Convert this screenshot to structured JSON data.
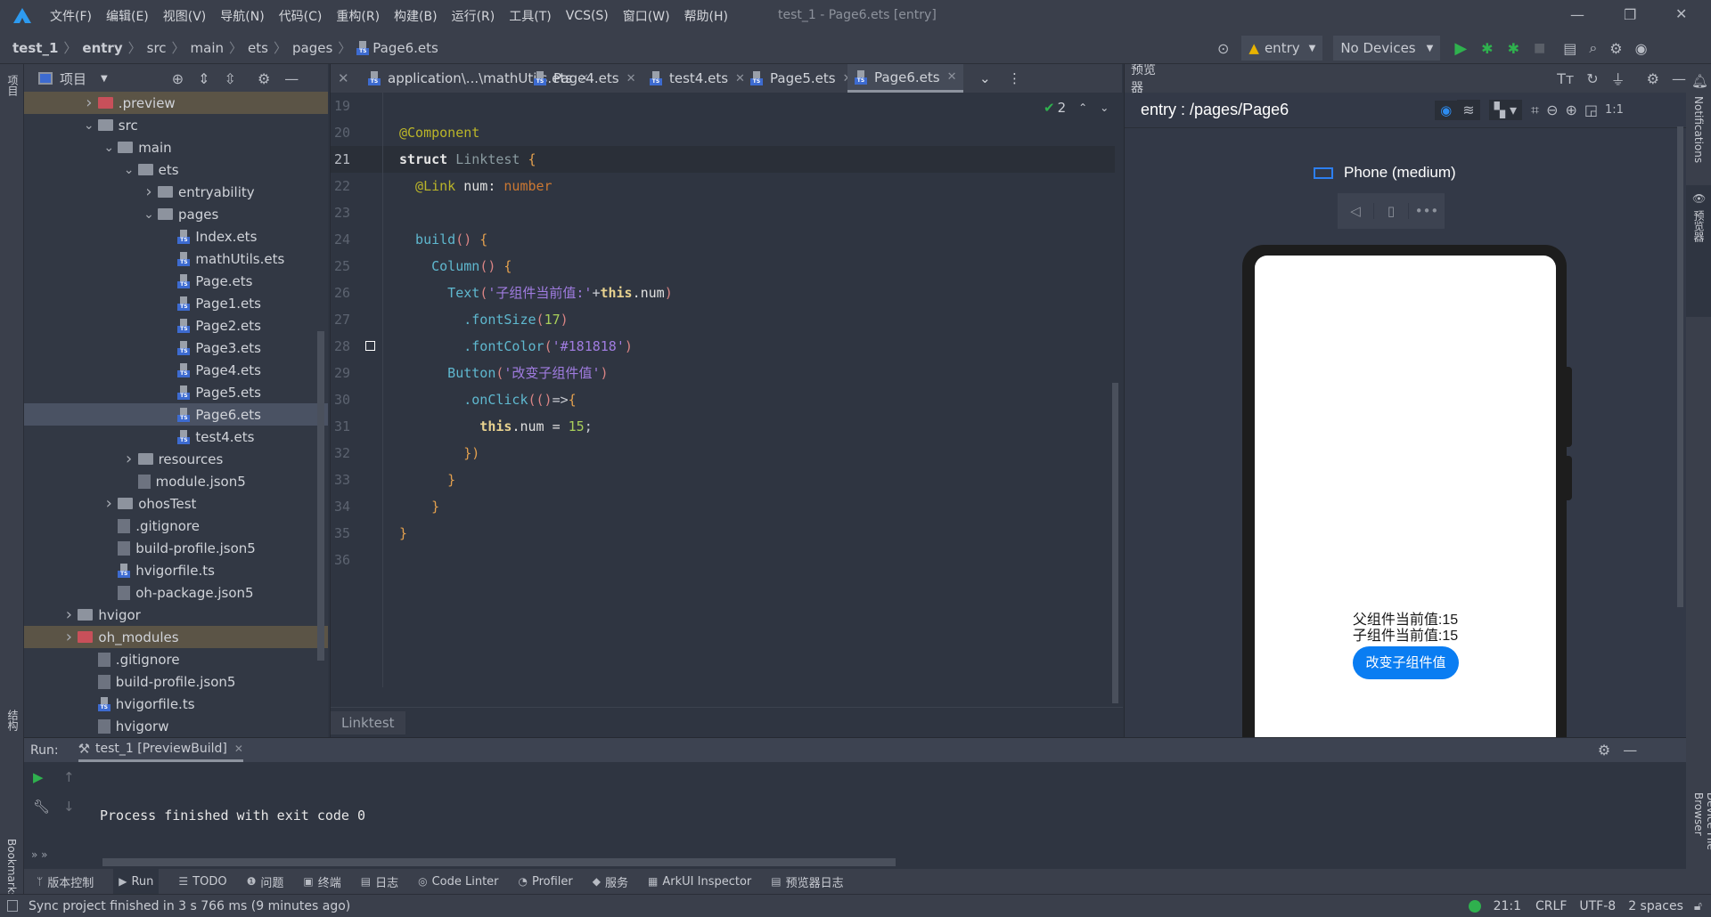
{
  "menu": {
    "items": [
      "文件(F)",
      "编辑(E)",
      "视图(V)",
      "导航(N)",
      "代码(C)",
      "重构(R)",
      "构建(B)",
      "运行(R)",
      "工具(T)",
      "VCS(S)",
      "窗口(W)",
      "帮助(H)"
    ],
    "window_title": "test_1 - Page6.ets [entry]"
  },
  "breadcrumb": [
    "test_1",
    "entry",
    "src",
    "main",
    "ets",
    "pages",
    "Page6.ets"
  ],
  "toolbar": {
    "module": "entry",
    "device": "No Devices"
  },
  "left_strip": {
    "project": "项目",
    "structure": "结构",
    "bookmarks": "Bookmarks"
  },
  "project": {
    "title": "项目",
    "tree": [
      {
        "label": ".preview",
        "depth": 2,
        "type": "folder",
        "expanded": false,
        "color": "red",
        "state": "highlight"
      },
      {
        "label": "src",
        "depth": 2,
        "type": "folder",
        "expanded": true
      },
      {
        "label": "main",
        "depth": 3,
        "type": "folder",
        "expanded": true
      },
      {
        "label": "ets",
        "depth": 4,
        "type": "folder",
        "expanded": true
      },
      {
        "label": "entryability",
        "depth": 5,
        "type": "folder",
        "expanded": false
      },
      {
        "label": "pages",
        "depth": 5,
        "type": "folder",
        "expanded": true
      },
      {
        "label": "Index.ets",
        "depth": 6,
        "type": "ts"
      },
      {
        "label": "mathUtils.ets",
        "depth": 6,
        "type": "ts"
      },
      {
        "label": "Page.ets",
        "depth": 6,
        "type": "ts"
      },
      {
        "label": "Page1.ets",
        "depth": 6,
        "type": "ts"
      },
      {
        "label": "Page2.ets",
        "depth": 6,
        "type": "ts"
      },
      {
        "label": "Page3.ets",
        "depth": 6,
        "type": "ts"
      },
      {
        "label": "Page4.ets",
        "depth": 6,
        "type": "ts"
      },
      {
        "label": "Page5.ets",
        "depth": 6,
        "type": "ts"
      },
      {
        "label": "Page6.ets",
        "depth": 6,
        "type": "ts",
        "state": "selected"
      },
      {
        "label": "test4.ets",
        "depth": 6,
        "type": "ts"
      },
      {
        "label": "resources",
        "depth": 4,
        "type": "folder",
        "expanded": false
      },
      {
        "label": "module.json5",
        "depth": 4,
        "type": "file"
      },
      {
        "label": "ohosTest",
        "depth": 3,
        "type": "folder",
        "expanded": false
      },
      {
        "label": ".gitignore",
        "depth": 3,
        "type": "file"
      },
      {
        "label": "build-profile.json5",
        "depth": 3,
        "type": "file"
      },
      {
        "label": "hvigorfile.ts",
        "depth": 3,
        "type": "ts"
      },
      {
        "label": "oh-package.json5",
        "depth": 3,
        "type": "file"
      },
      {
        "label": "hvigor",
        "depth": 1,
        "type": "folder",
        "expanded": false
      },
      {
        "label": "oh_modules",
        "depth": 1,
        "type": "folder",
        "expanded": false,
        "color": "red",
        "state": "highlight"
      },
      {
        "label": ".gitignore",
        "depth": 2,
        "type": "file"
      },
      {
        "label": "build-profile.json5",
        "depth": 2,
        "type": "file"
      },
      {
        "label": "hvigorfile.ts",
        "depth": 2,
        "type": "ts"
      },
      {
        "label": "hvigorw",
        "depth": 2,
        "type": "file"
      }
    ]
  },
  "editor": {
    "tabs": [
      "application\\...\\mathUtils.ets",
      "Page4.ets",
      "test4.ets",
      "Page5.ets",
      "Page6.ets"
    ],
    "active_tab": "Page6.ets",
    "inspection_count": "2",
    "current_line": 21,
    "lines": [
      {
        "n": "19",
        "tokens": []
      },
      {
        "n": "20",
        "tokens": [
          [
            "@Component",
            "ann"
          ]
        ]
      },
      {
        "n": "21",
        "tokens": [
          [
            "struct",
            "kw"
          ],
          [
            " ",
            "op"
          ],
          [
            "Linktest",
            "cls"
          ],
          [
            " {",
            "br"
          ]
        ]
      },
      {
        "n": "22",
        "tokens": [
          [
            "  @Link",
            "ann"
          ],
          [
            " num: ",
            "id"
          ],
          [
            "number",
            "type"
          ]
        ]
      },
      {
        "n": "23",
        "tokens": []
      },
      {
        "n": "24",
        "tokens": [
          [
            "  build",
            "fn"
          ],
          [
            "()",
            "par"
          ],
          [
            " {",
            "br"
          ]
        ]
      },
      {
        "n": "25",
        "tokens": [
          [
            "    Column",
            "fn"
          ],
          [
            "()",
            "par"
          ],
          [
            " {",
            "br"
          ]
        ]
      },
      {
        "n": "26",
        "tokens": [
          [
            "      Text",
            "fn"
          ],
          [
            "(",
            "par"
          ],
          [
            "'子组件当前值:'",
            "str"
          ],
          [
            "+",
            "op"
          ],
          [
            "this",
            "this"
          ],
          [
            ".num",
            "id"
          ],
          [
            ")",
            "par"
          ]
        ]
      },
      {
        "n": "27",
        "tokens": [
          [
            "        .fontSize",
            "fn"
          ],
          [
            "(",
            "par"
          ],
          [
            "17",
            "num"
          ],
          [
            ")",
            "par"
          ]
        ]
      },
      {
        "n": "28",
        "tokens": [
          [
            "        .fontColor",
            "fn"
          ],
          [
            "(",
            "par"
          ],
          [
            "'#181818'",
            "str"
          ],
          [
            ")",
            "par"
          ]
        ]
      },
      {
        "n": "29",
        "tokens": [
          [
            "      Button",
            "fn"
          ],
          [
            "(",
            "par"
          ],
          [
            "'改变子组件值'",
            "str"
          ],
          [
            ")",
            "par"
          ]
        ]
      },
      {
        "n": "30",
        "tokens": [
          [
            "        .onClick",
            "fn"
          ],
          [
            "(()",
            "par"
          ],
          [
            "=>",
            "op"
          ],
          [
            "{",
            "br"
          ]
        ]
      },
      {
        "n": "31",
        "tokens": [
          [
            "          this",
            "this"
          ],
          [
            ".num = ",
            "id"
          ],
          [
            "15",
            "num"
          ],
          [
            ";",
            "op"
          ]
        ]
      },
      {
        "n": "32",
        "tokens": [
          [
            "        })",
            "br"
          ]
        ]
      },
      {
        "n": "33",
        "tokens": [
          [
            "      }",
            "br"
          ]
        ]
      },
      {
        "n": "34",
        "tokens": [
          [
            "    }",
            "br"
          ]
        ]
      },
      {
        "n": "35",
        "tokens": [
          [
            "}",
            "br"
          ]
        ]
      },
      {
        "n": "36",
        "tokens": []
      }
    ],
    "footer_crumb": "Linktest"
  },
  "preview": {
    "title": "预览器",
    "route": "entry : /pages/Page6",
    "device": "Phone (medium)",
    "screen": {
      "parent_text": "父组件当前值:15",
      "child_text": "子组件当前值:15",
      "button": "改变子组件值",
      "button_color": "#0a7df2"
    }
  },
  "right_strip": {
    "notifications": "Notifications",
    "previewer": "预览器",
    "device_browser": "Device File Browser"
  },
  "run": {
    "label": "Run:",
    "config": "test_1 [PreviewBuild]",
    "output": "Process finished with exit code 0"
  },
  "tool_tabs": [
    "版本控制",
    "Run",
    "TODO",
    "问题",
    "终端",
    "日志",
    "Code Linter",
    "Profiler",
    "服务",
    "ArkUI Inspector",
    "预览器日志"
  ],
  "tool_tab_active": "Run",
  "status": {
    "message": "Sync project finished in 3 s 766 ms (9 minutes ago)",
    "position": "21:1",
    "line_sep": "CRLF",
    "encoding": "UTF-8",
    "indent": "2 spaces"
  }
}
